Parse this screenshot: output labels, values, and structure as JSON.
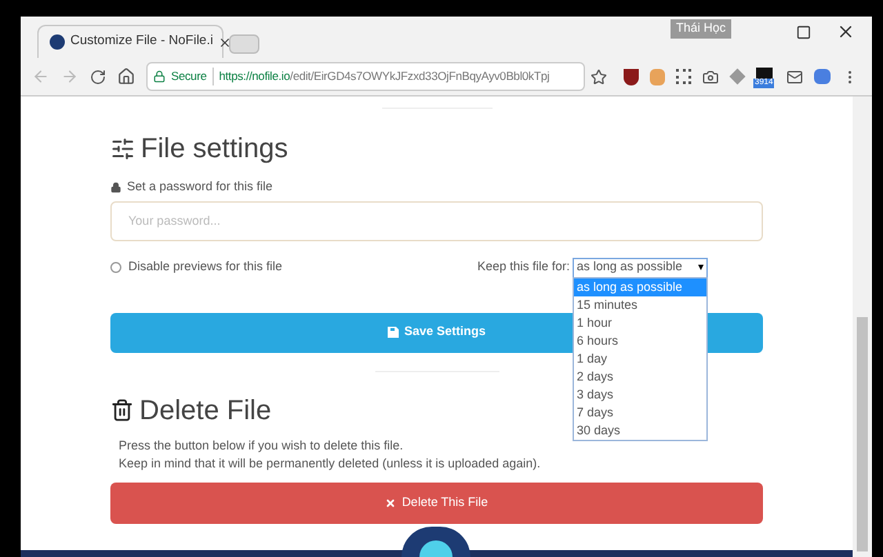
{
  "browser": {
    "tab_title": "Customize File - NoFile.i",
    "profile": "Thái Học",
    "secure_label": "Secure",
    "url_host": "https://nofile.io",
    "url_path": "/edit/EirGD4s7OWYkJFzxd33OjFnBqyAyv0Bbl0kTpj",
    "extension_badge": "3914"
  },
  "settings": {
    "title": "File settings",
    "password_label": "Set a password for this file",
    "password_placeholder": "Your password...",
    "disable_previews": {
      "label": "Disable previews for this file",
      "checked": false
    },
    "keep_label": "Keep this file for:",
    "keep_value": "as long as possible",
    "keep_options": [
      {
        "label": "as long as possible",
        "selected": true
      },
      {
        "label": "15 minutes",
        "selected": false
      },
      {
        "label": "1 hour",
        "selected": false
      },
      {
        "label": "6 hours",
        "selected": false
      },
      {
        "label": "1 day",
        "selected": false
      },
      {
        "label": "2 days",
        "selected": false
      },
      {
        "label": "3 days",
        "selected": false
      },
      {
        "label": "7 days",
        "selected": false
      },
      {
        "label": "30 days",
        "selected": false
      }
    ],
    "save_button": "Save Settings"
  },
  "delete": {
    "title": "Delete File",
    "lines": [
      "Press the button below if you wish to delete this file.",
      "Keep in mind that it will be permanently deleted (unless it is uploaded again)."
    ],
    "button": "Delete This File"
  }
}
